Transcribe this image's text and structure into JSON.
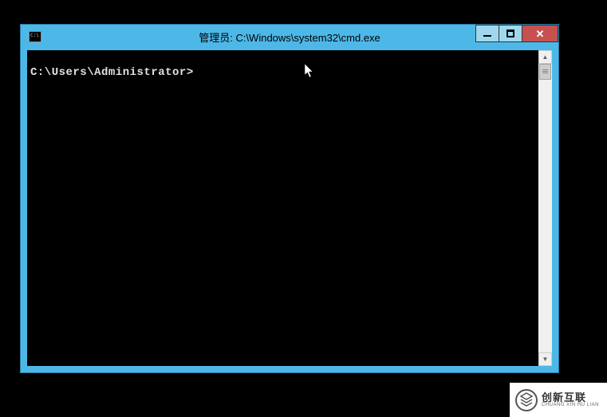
{
  "window": {
    "title": "管理员: C:\\Windows\\system32\\cmd.exe"
  },
  "console": {
    "prompt": "C:\\Users\\Administrator>"
  },
  "watermark": {
    "brand_main": "创新互联",
    "brand_sub": "CHUANG XIN HU LIAN"
  }
}
